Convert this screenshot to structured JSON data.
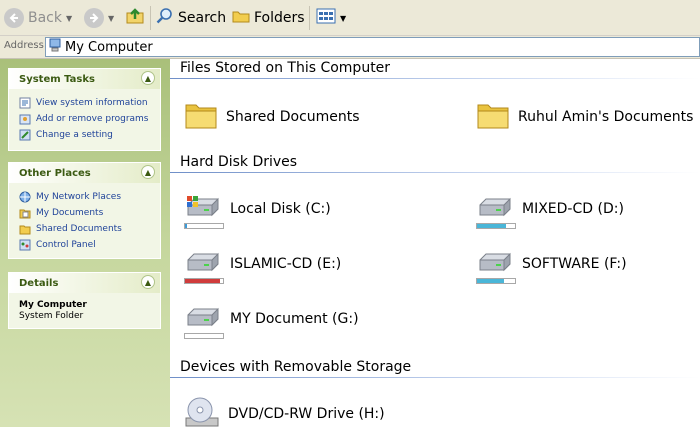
{
  "toolbar": {
    "back_label": "Back",
    "search_label": "Search",
    "folders_label": "Folders"
  },
  "address": {
    "label": "Address",
    "value": "My Computer"
  },
  "left_panel": {
    "system_tasks": {
      "title": "System Tasks",
      "items": [
        "View system information",
        "Add or remove programs",
        "Change a setting"
      ]
    },
    "other_places": {
      "title": "Other Places",
      "items": [
        "My Network Places",
        "My Documents",
        "Shared Documents",
        "Control Panel"
      ]
    },
    "details": {
      "title": "Details",
      "name": "My Computer",
      "type": "System Folder"
    }
  },
  "main": {
    "files_section": {
      "title": "Files Stored on This Computer",
      "items": [
        "Shared Documents",
        "Ruhul Amin's Documents"
      ]
    },
    "hdd_section": {
      "title": "Hard Disk Drives",
      "drives": [
        {
          "label": "Local Disk (C:)",
          "used_fraction": 0.06,
          "bar_color": "#3c9ad8"
        },
        {
          "label": "MIXED-CD (D:)",
          "used_fraction": 0.75,
          "bar_color": "#4ab6d8"
        },
        {
          "label": "ISLAMIC-CD (E:)",
          "used_fraction": 0.92,
          "bar_color": "#d03c3c"
        },
        {
          "label": "SOFTWARE (F:)",
          "used_fraction": 0.7,
          "bar_color": "#4ab6d8"
        },
        {
          "label": "MY Document (G:)",
          "used_fraction": 0.0,
          "bar_color": "#4ab6d8"
        }
      ]
    },
    "removable_section": {
      "title": "Devices with Removable Storage",
      "items": [
        "DVD/CD-RW Drive (H:)"
      ]
    }
  },
  "colors": {
    "task_link": "#21449a",
    "panel_heading": "#3b5a12",
    "accent_green": "#a9c07a"
  }
}
